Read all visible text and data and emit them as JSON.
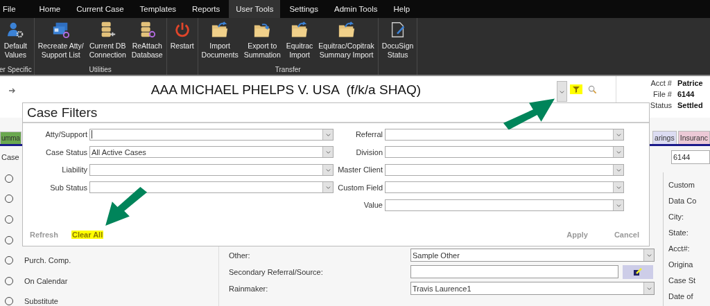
{
  "menu": [
    {
      "label": "File",
      "selected": false
    },
    {
      "label": "Home",
      "selected": false
    },
    {
      "label": "Current Case",
      "selected": false
    },
    {
      "label": "Templates",
      "selected": false
    },
    {
      "label": "Reports",
      "selected": false
    },
    {
      "label": "User Tools",
      "selected": true
    },
    {
      "label": "Settings",
      "selected": false
    },
    {
      "label": "Admin Tools",
      "selected": false
    },
    {
      "label": "Help",
      "selected": false
    }
  ],
  "ribbon": [
    {
      "label": "er Specific",
      "buttons": [
        {
          "kind": "user-settings",
          "lines": [
            "Default",
            "Values"
          ]
        }
      ]
    },
    {
      "label": "Utilities",
      "buttons": [
        {
          "kind": "cards",
          "lines": [
            "Recreate Atty/",
            "Support List"
          ]
        },
        {
          "kind": "database-plug",
          "lines": [
            "Current DB",
            "Connection"
          ]
        },
        {
          "kind": "database-sync",
          "lines": [
            "ReAttach",
            "Database"
          ]
        }
      ]
    },
    {
      "buttons": [
        {
          "kind": "power",
          "lines": [
            "Restart"
          ]
        }
      ]
    },
    {
      "label": "Transfer",
      "buttons": [
        {
          "kind": "folder-import",
          "lines": [
            "Import",
            "Documents"
          ]
        },
        {
          "kind": "folder-export",
          "lines": [
            "Export to",
            "Summation"
          ]
        },
        {
          "kind": "folder-import",
          "lines": [
            "Equitrac",
            "Import"
          ]
        },
        {
          "kind": "folder-import",
          "lines": [
            "Equitrac/Copitrak",
            "Summary Import"
          ]
        }
      ]
    },
    {
      "buttons": [
        {
          "kind": "document-sign",
          "lines": [
            "DocuSign",
            "Status"
          ]
        }
      ]
    }
  ],
  "case_title": "AAA MICHAEL PHELPS V. USA  (f/k/a SHAQ)",
  "filter_button": {
    "highlighted": true
  },
  "case_info": [
    {
      "label": "Acct #",
      "value": "Patrice"
    },
    {
      "label": "File #",
      "value": "6144"
    },
    {
      "label": "Status",
      "value": "Settled"
    }
  ],
  "tabs": [
    {
      "label": "umma",
      "color": "#6aa84f"
    },
    {
      "label": "arings",
      "color": "#dcdcf2"
    },
    {
      "label": "Insuranc",
      "color": "#ecc9d6"
    }
  ],
  "case_row": {
    "label": "Case",
    "value": "6144"
  },
  "radios": [
    {
      "checked": false
    },
    {
      "checked": false
    },
    {
      "checked": false
    },
    {
      "checked": false
    },
    {
      "label": "Purch. Comp.",
      "checked": false
    },
    {
      "label": "On Calendar",
      "checked": false
    },
    {
      "label": "Substitute",
      "checked": false
    }
  ],
  "fields": [
    {
      "kind": "dropdown",
      "label": "Other:",
      "value": "Sample Other"
    },
    {
      "kind": "lookup",
      "label": "Secondary Referral/Source:"
    },
    {
      "kind": "dropdown",
      "label": "Rainmaker:",
      "value": "Travis Laurence1"
    }
  ],
  "right_labels": [
    "Custom",
    "Data Co",
    "City:",
    "State:",
    "Acct#:",
    "Origina",
    "Case St",
    "Date of"
  ],
  "case_filters": {
    "title": "Case Filters",
    "left": [
      {
        "label": "Atty/Support",
        "focused": true
      },
      {
        "label": "Case Status",
        "value": "All Active Cases"
      },
      {
        "label": "Liability"
      },
      {
        "label": "Sub Status"
      }
    ],
    "right": [
      {
        "label": "Referral"
      },
      {
        "label": "Division"
      },
      {
        "label": "Master Client"
      },
      {
        "label": "Custom Field"
      },
      {
        "label": "Value"
      }
    ],
    "actions": [
      {
        "label": "Refresh",
        "disabled": true,
        "highlighted": false
      },
      {
        "label": "Clear All",
        "disabled": false,
        "highlighted": true
      },
      {
        "label": "Apply",
        "disabled": true,
        "highlighted": false
      },
      {
        "label": "Cancel",
        "disabled": true,
        "highlighted": false
      }
    ]
  }
}
